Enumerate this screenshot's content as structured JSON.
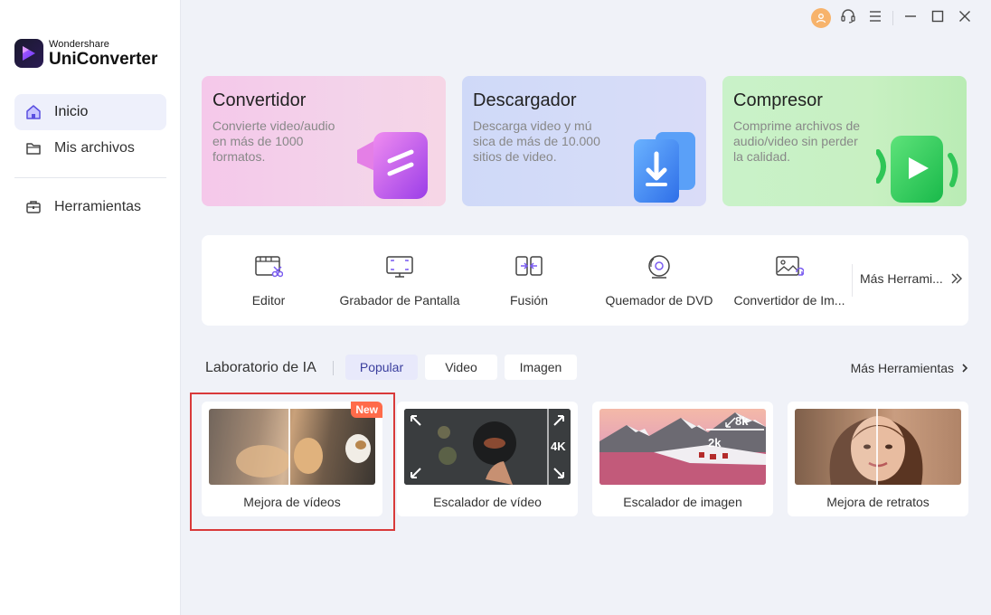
{
  "app": {
    "logo_sub": "Wondershare",
    "logo_main": "UniConverter"
  },
  "sidebar": {
    "items": [
      {
        "label": "Inicio",
        "icon": "home-icon",
        "active": true
      },
      {
        "label": "Mis archivos",
        "icon": "folder-icon",
        "active": false
      },
      {
        "label": "Herramientas",
        "icon": "toolbox-icon",
        "active": false
      }
    ]
  },
  "window_controls": [
    "account-icon",
    "support-icon",
    "menu-icon",
    "minimize-icon",
    "maximize-icon",
    "close-icon"
  ],
  "feature_cards": [
    {
      "title": "Convertidor",
      "desc": "Convierte video/audio en más de 1000 formatos."
    },
    {
      "title": "Descargador",
      "desc": "Descarga video y mú sica de más de 10.000 sitios de video."
    },
    {
      "title": "Compresor",
      "desc": "Comprime archivos de audio/video sin perder la calidad."
    }
  ],
  "tools": {
    "items": [
      {
        "label": "Editor",
        "icon": "video-edit-icon"
      },
      {
        "label": "Grabador de Pantalla",
        "icon": "screen-record-icon"
      },
      {
        "label": "Fusión",
        "icon": "merge-icon"
      },
      {
        "label": "Quemador de DVD",
        "icon": "dvd-burn-icon"
      },
      {
        "label": "Convertidor de Im...",
        "icon": "image-convert-icon"
      }
    ],
    "more_label": "Más Herrami..."
  },
  "ai_lab": {
    "title": "Laboratorio de IA",
    "tabs": [
      "Popular",
      "Video",
      "Imagen"
    ],
    "active_tab": "Popular",
    "more_label": "Más Herramientas",
    "cards": [
      {
        "label": "Mejora de vídeos",
        "badge": "New"
      },
      {
        "label": "Escalador de vídeo",
        "res": "4K"
      },
      {
        "label": "Escalador de imagen",
        "res_hi": "8k",
        "res_lo": "2k"
      },
      {
        "label": "Mejora de retratos"
      }
    ]
  },
  "colors": {
    "accent": "#3b3f9e",
    "highlight_border": "#d93a3a",
    "badge": "#ff6b4a"
  }
}
